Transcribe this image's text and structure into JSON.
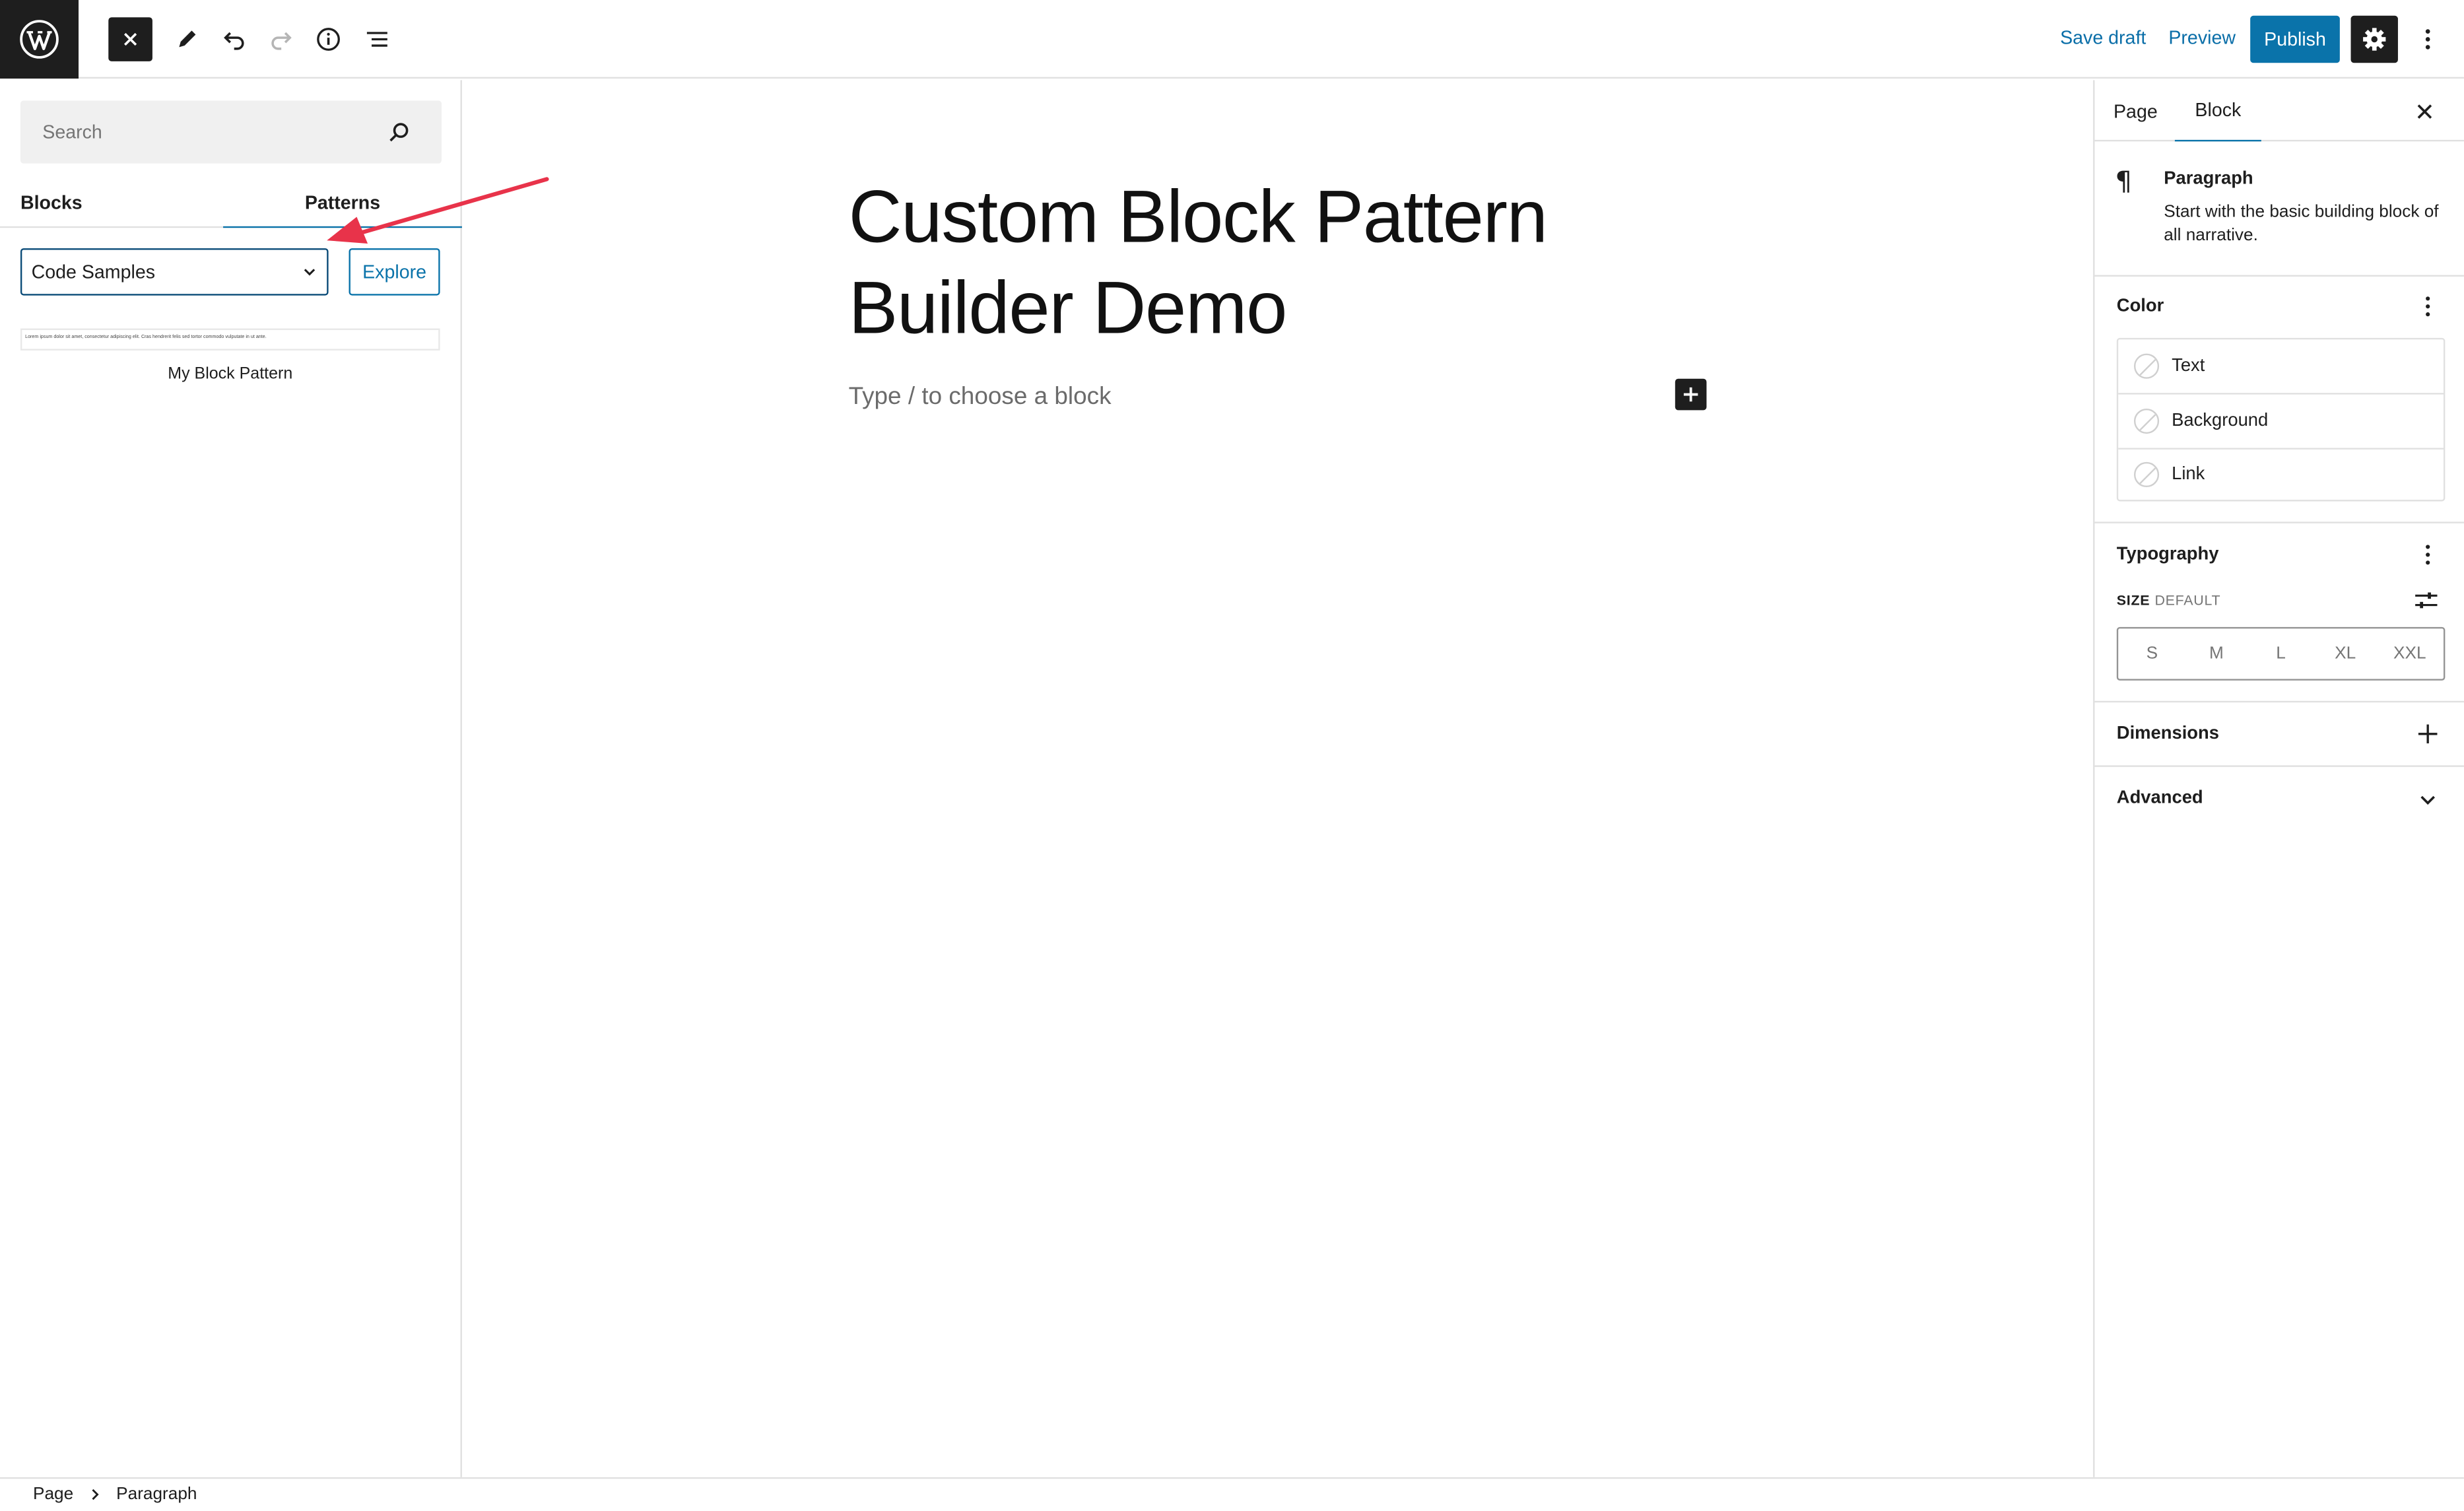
{
  "toolbar": {
    "save_draft": "Save draft",
    "preview": "Preview",
    "publish": "Publish",
    "icons": [
      "wordpress-logo",
      "close-icon",
      "pencil-icon",
      "undo-icon",
      "redo-icon",
      "info-icon",
      "list-view-icon",
      "settings-gear-icon",
      "more-options-icon"
    ]
  },
  "inserter": {
    "search_placeholder": "Search",
    "tabs": [
      "Blocks",
      "Patterns"
    ],
    "active_tab": "Patterns",
    "category_selected": "Code Samples",
    "explore_label": "Explore",
    "pattern_preview_text": "Lorem ipsum dolor sit amet, consectetur adipiscing elit. Cras hendrerit felis sed tortor commodo vulputate in ut ante.",
    "pattern_title": "My Block Pattern"
  },
  "canvas": {
    "title": "Custom Block Pattern Builder Demo",
    "placeholder": "Type / to choose a block"
  },
  "sidebar": {
    "tabs": [
      "Page",
      "Block"
    ],
    "active_tab": "Block",
    "block": {
      "name": "Paragraph",
      "description": "Start with the basic building block of all narrative."
    },
    "color": {
      "title": "Color",
      "items": [
        "Text",
        "Background",
        "Link"
      ]
    },
    "typography": {
      "title": "Typography",
      "size_label": "SIZE",
      "size_value": "DEFAULT",
      "sizes": [
        "S",
        "M",
        "L",
        "XL",
        "XXL"
      ]
    },
    "dimensions": {
      "title": "Dimensions"
    },
    "advanced": {
      "title": "Advanced"
    }
  },
  "footer": {
    "breadcrumb": [
      "Page",
      "Paragraph"
    ]
  },
  "colors": {
    "accent": "#0a73aa",
    "dark": "#1e1e1e",
    "annotation_arrow": "#e8334a"
  }
}
